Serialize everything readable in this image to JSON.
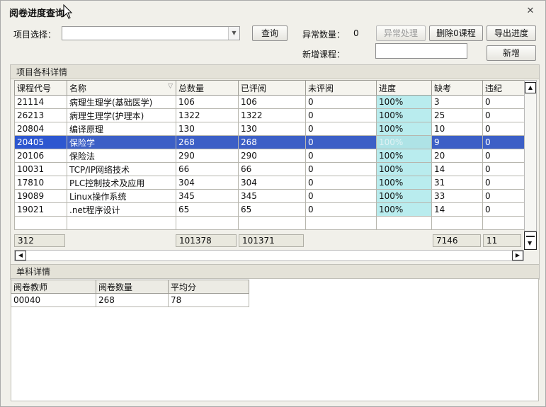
{
  "window": {
    "title": "阅卷进度查询",
    "close_glyph": "✕"
  },
  "toolbar": {
    "project_label": "项目选择：",
    "project_value": "",
    "query_button": "查询",
    "abnormal_label": "异常数量：",
    "abnormal_count": "0",
    "abnormal_button": "异常处理",
    "delete_zero_button": "删除0课程",
    "export_button": "导出进度",
    "new_course_label": "新增课程：",
    "new_course_value": "",
    "add_button": "新增"
  },
  "subject_group": {
    "title": "项目各科详情",
    "columns": [
      "课程代号",
      "名称",
      "总数量",
      "已评阅",
      "未评阅",
      "进度",
      "缺考",
      "违纪"
    ],
    "rows": [
      {
        "code": "21114",
        "name": "病理生理学(基础医学)",
        "total": "106",
        "reviewed": "106",
        "unreviewed": "0",
        "progress": "100%",
        "absent": "3",
        "violation": "0"
      },
      {
        "code": "26213",
        "name": "病理生理学(护理本)",
        "total": "1322",
        "reviewed": "1322",
        "unreviewed": "0",
        "progress": "100%",
        "absent": "25",
        "violation": "0"
      },
      {
        "code": "20804",
        "name": "编译原理",
        "total": "130",
        "reviewed": "130",
        "unreviewed": "0",
        "progress": "100%",
        "absent": "10",
        "violation": "0"
      },
      {
        "code": "20405",
        "name": "保险学",
        "total": "268",
        "reviewed": "268",
        "unreviewed": "0",
        "progress": "100%",
        "absent": "9",
        "violation": "0"
      },
      {
        "code": "20106",
        "name": "保险法",
        "total": "290",
        "reviewed": "290",
        "unreviewed": "0",
        "progress": "100%",
        "absent": "20",
        "violation": "0"
      },
      {
        "code": "10031",
        "name": "TCP/IP网络技术",
        "total": "66",
        "reviewed": "66",
        "unreviewed": "0",
        "progress": "100%",
        "absent": "14",
        "violation": "0"
      },
      {
        "code": "17810",
        "name": "PLC控制技术及应用",
        "total": "304",
        "reviewed": "304",
        "unreviewed": "0",
        "progress": "100%",
        "absent": "31",
        "violation": "0"
      },
      {
        "code": "19089",
        "name": "Linux操作系统",
        "total": "345",
        "reviewed": "345",
        "unreviewed": "0",
        "progress": "100%",
        "absent": "33",
        "violation": "0"
      },
      {
        "code": "19021",
        "name": ".net程序设计",
        "total": "65",
        "reviewed": "65",
        "unreviewed": "0",
        "progress": "100%",
        "absent": "14",
        "violation": "0"
      }
    ],
    "selected_row": 3,
    "summary": {
      "count": "312",
      "total": "101378",
      "reviewed": "101371",
      "absent": "7146",
      "violation": "11"
    }
  },
  "single_group": {
    "title": "单科详情",
    "columns": [
      "阅卷教师",
      "阅卷数量",
      "平均分"
    ],
    "rows": [
      {
        "teacher": "00040",
        "count": "268",
        "avg": "78"
      }
    ]
  },
  "colors": {
    "selection": "#3c5fc6",
    "progress_cell": "#b9ecee",
    "panel_bg": "#f1f0ea"
  }
}
